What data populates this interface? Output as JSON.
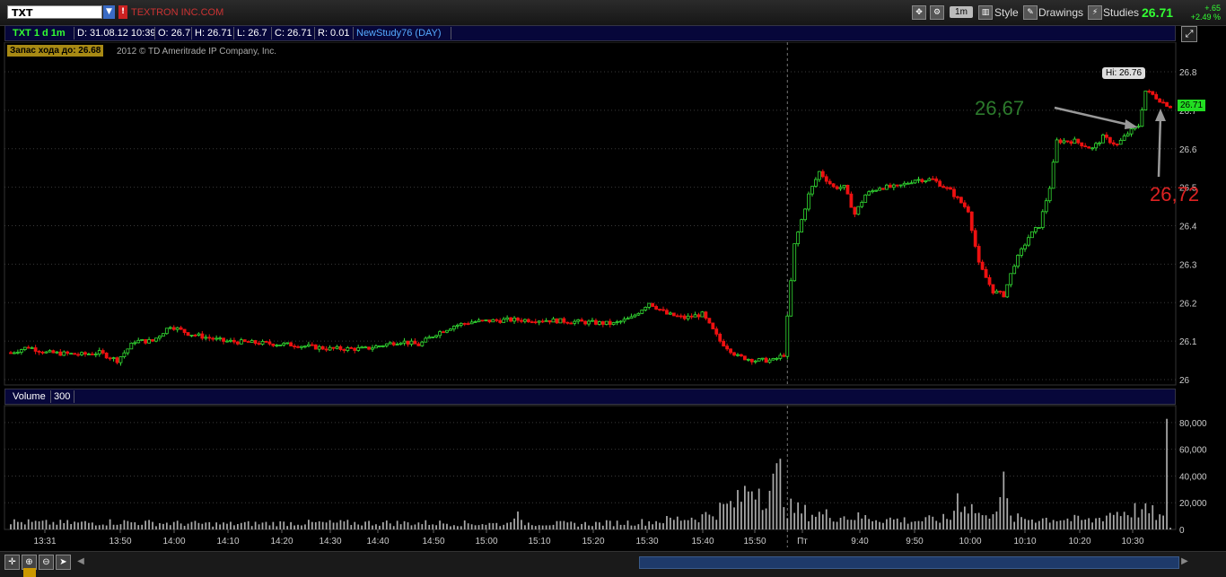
{
  "toolbar": {
    "symbol": "TXT",
    "flag": "!",
    "company": "TEXTRON INC.COM",
    "timeframe": "1m",
    "style_label": "Style",
    "drawings_label": "Drawings",
    "studies_label": "Studies",
    "last_price": "26.71",
    "change_abs": "+.65",
    "change_pct": "+2.49 %"
  },
  "infobar": {
    "symbol_period": "TXT 1 d 1m",
    "date": "D: 31.08.12 10:39",
    "open": "O: 26.7",
    "high": "H: 26.71",
    "low": "L: 26.7",
    "close": "C: 26.71",
    "range": "R: 0.01",
    "study": "NewStudy76 (DAY)"
  },
  "reach_label": "Запас хода до: 26.68",
  "copyright": "2012 © TD Ameritrade IP Company, Inc.",
  "volume_panel": {
    "label": "Volume",
    "value": "300"
  },
  "annotations": {
    "green_note": "26,67",
    "red_note": "26,72",
    "hi_label": "Hi: 26.76",
    "last_label": "26.71"
  },
  "colors": {
    "up": "#33dd33",
    "down": "#ee1111",
    "background": "#000000",
    "grid": "#3a3a3a",
    "volume": "#aaaaaa"
  },
  "chart_data": {
    "type": "candlestick",
    "title": "",
    "ylim": [
      26,
      26.8
    ],
    "y_ticks": [
      "26",
      "26.1",
      "26.2",
      "26.3",
      "26.4",
      "26.5",
      "26.6",
      "26.7",
      "26.8"
    ],
    "volume_ticks": [
      "0",
      "20,000",
      "40,000",
      "60,000",
      "80,000"
    ],
    "x_ticks": [
      "13:31",
      "13:50",
      "14:00",
      "14:10",
      "14:20",
      "14:30",
      "14:40",
      "14:50",
      "15:00",
      "15:10",
      "15:20",
      "15:30",
      "15:40",
      "15:50",
      "Пт",
      "9:40",
      "9:50",
      "10:00",
      "10:10",
      "10:20",
      "10:30"
    ],
    "price_keyframes": [
      [
        0,
        26.07
      ],
      [
        5,
        26.085
      ],
      [
        10,
        26.07
      ],
      [
        20,
        26.065
      ],
      [
        25,
        26.07
      ],
      [
        30,
        26.05
      ],
      [
        35,
        26.1
      ],
      [
        40,
        26.1
      ],
      [
        45,
        26.14
      ],
      [
        50,
        26.12
      ],
      [
        60,
        26.1
      ],
      [
        70,
        26.095
      ],
      [
        80,
        26.09
      ],
      [
        90,
        26.08
      ],
      [
        100,
        26.08
      ],
      [
        110,
        26.1
      ],
      [
        115,
        26.09
      ],
      [
        120,
        26.12
      ],
      [
        125,
        26.14
      ],
      [
        130,
        26.15
      ],
      [
        140,
        26.155
      ],
      [
        150,
        26.155
      ],
      [
        160,
        26.15
      ],
      [
        170,
        26.145
      ],
      [
        175,
        26.16
      ],
      [
        180,
        26.2
      ],
      [
        185,
        26.17
      ],
      [
        190,
        26.16
      ],
      [
        195,
        26.17
      ],
      [
        200,
        26.1
      ],
      [
        205,
        26.06
      ],
      [
        210,
        26.05
      ],
      [
        215,
        26.05
      ],
      [
        218,
        26.065
      ],
      [
        221,
        26.35
      ],
      [
        225,
        26.48
      ],
      [
        228,
        26.54
      ],
      [
        232,
        26.5
      ],
      [
        235,
        26.5
      ],
      [
        238,
        26.43
      ],
      [
        241,
        26.48
      ],
      [
        245,
        26.5
      ],
      [
        250,
        26.5
      ],
      [
        255,
        26.52
      ],
      [
        260,
        26.52
      ],
      [
        265,
        26.49
      ],
      [
        270,
        26.44
      ],
      [
        273,
        26.3
      ],
      [
        277,
        26.23
      ],
      [
        280,
        26.22
      ],
      [
        283,
        26.3
      ],
      [
        287,
        26.37
      ],
      [
        290,
        26.4
      ],
      [
        293,
        26.5
      ],
      [
        295,
        26.62
      ],
      [
        300,
        26.62
      ],
      [
        305,
        26.6
      ],
      [
        308,
        26.63
      ],
      [
        312,
        26.61
      ],
      [
        315,
        26.64
      ],
      [
        318,
        26.66
      ],
      [
        320,
        26.75
      ],
      [
        322,
        26.74
      ],
      [
        325,
        26.72
      ],
      [
        327,
        26.71
      ]
    ],
    "volume_keyframes": [
      [
        0,
        0.07
      ],
      [
        10,
        0.06
      ],
      [
        20,
        0.06
      ],
      [
        30,
        0.07
      ],
      [
        40,
        0.06
      ],
      [
        60,
        0.05
      ],
      [
        80,
        0.06
      ],
      [
        100,
        0.06
      ],
      [
        120,
        0.06
      ],
      [
        140,
        0.05
      ],
      [
        142,
        0.18
      ],
      [
        144,
        0.06
      ],
      [
        160,
        0.05
      ],
      [
        180,
        0.07
      ],
      [
        195,
        0.12
      ],
      [
        205,
        0.25
      ],
      [
        208,
        0.38
      ],
      [
        210,
        0.45
      ],
      [
        212,
        0.35
      ],
      [
        215,
        0.4
      ],
      [
        217,
        0.5
      ],
      [
        219,
        0.2
      ],
      [
        225,
        0.15
      ],
      [
        235,
        0.12
      ],
      [
        245,
        0.1
      ],
      [
        255,
        0.08
      ],
      [
        265,
        0.1
      ],
      [
        267,
        0.3
      ],
      [
        275,
        0.1
      ],
      [
        280,
        0.38
      ],
      [
        282,
        0.1
      ],
      [
        295,
        0.1
      ],
      [
        305,
        0.08
      ],
      [
        310,
        0.15
      ],
      [
        318,
        0.18
      ],
      [
        322,
        0.15
      ],
      [
        325,
        0.1
      ],
      [
        326,
        0.92
      ],
      [
        327,
        0.02
      ]
    ]
  }
}
